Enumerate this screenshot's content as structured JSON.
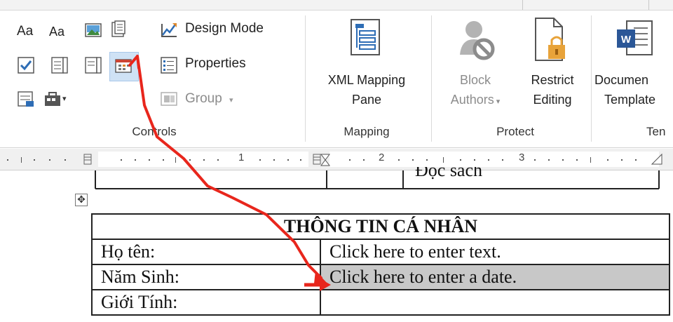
{
  "ribbon": {
    "groups": {
      "controls": {
        "label": "Controls",
        "buttons": {
          "design_mode": "Design Mode",
          "properties": "Properties",
          "group": "Group"
        },
        "icons": [
          "rich-text-content-control-icon",
          "plain-text-content-control-icon",
          "picture-content-control-icon",
          "building-block-gallery-icon",
          "checkbox-content-control-icon",
          "combo-box-content-control-icon",
          "drop-down-list-content-control-icon",
          "date-picker-content-control-icon",
          "repeating-section-content-control-icon",
          "legacy-tools-icon"
        ]
      },
      "mapping": {
        "label": "Mapping",
        "xml_mapping_line1": "XML Mapping",
        "xml_mapping_line2": "Pane"
      },
      "protect": {
        "label": "Protect",
        "block_line1": "Block",
        "block_line2": "Authors",
        "restrict_line1": "Restrict",
        "restrict_line2": "Editing"
      },
      "templates": {
        "label": "Ten",
        "doc_line1": "Documen",
        "doc_line2": "Template"
      }
    }
  },
  "ruler": {
    "numbers": [
      "1",
      "2",
      "3"
    ]
  },
  "document": {
    "above_table_text": "Đọc sách",
    "table": {
      "header": "THÔNG TIN CÁ NHÂN",
      "rows": [
        {
          "label": "Họ tên:",
          "value": "Click here to enter text."
        },
        {
          "label": "Năm Sinh:",
          "value": "Click here to enter a date."
        },
        {
          "label": "Giới Tính:",
          "value": ""
        }
      ]
    }
  },
  "annotation": {
    "arrow_color": "#e8261c"
  }
}
